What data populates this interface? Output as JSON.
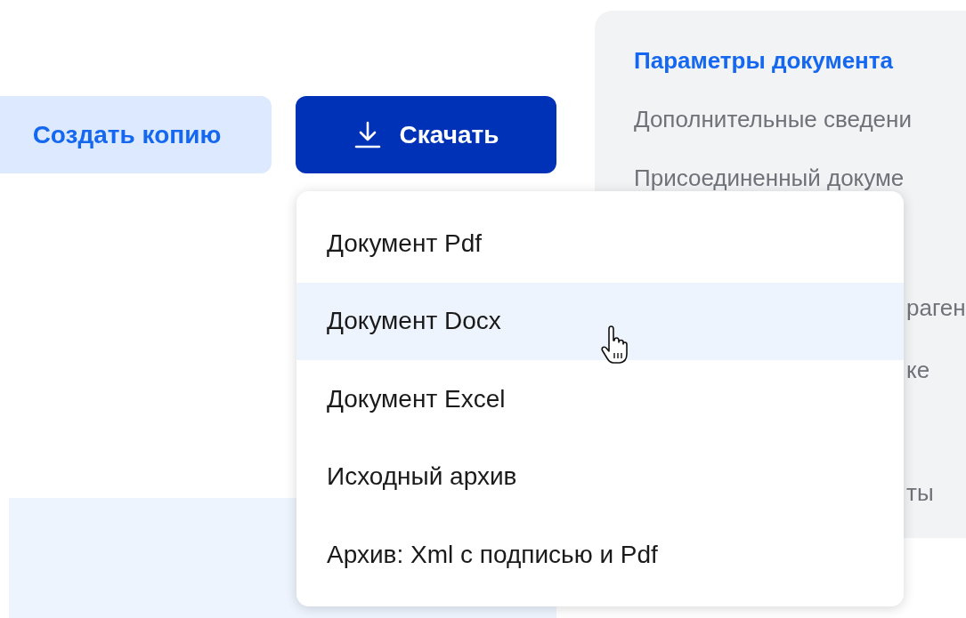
{
  "actions": [
    {
      "kind": "secondary",
      "label": "Создать копию"
    },
    {
      "kind": "primary",
      "label": "Скачать"
    }
  ],
  "download_menu": {
    "items": [
      {
        "label": "Документ Pdf",
        "selected": false
      },
      {
        "label": "Документ Docx",
        "selected": true
      },
      {
        "label": "Документ Excel",
        "selected": false
      },
      {
        "label": "Исходный архив",
        "selected": false
      },
      {
        "label": "Архив: Xml с подписью и Pdf",
        "selected": false
      }
    ]
  },
  "side_panel": {
    "items": [
      {
        "label": "Параметры документа",
        "selected": true
      },
      {
        "label": "Дополнительные сведени",
        "selected": false
      },
      {
        "label": "Присоединенный докуме",
        "selected": false
      }
    ],
    "partly_hidden": [
      "раген",
      "ке",
      "ты"
    ]
  }
}
